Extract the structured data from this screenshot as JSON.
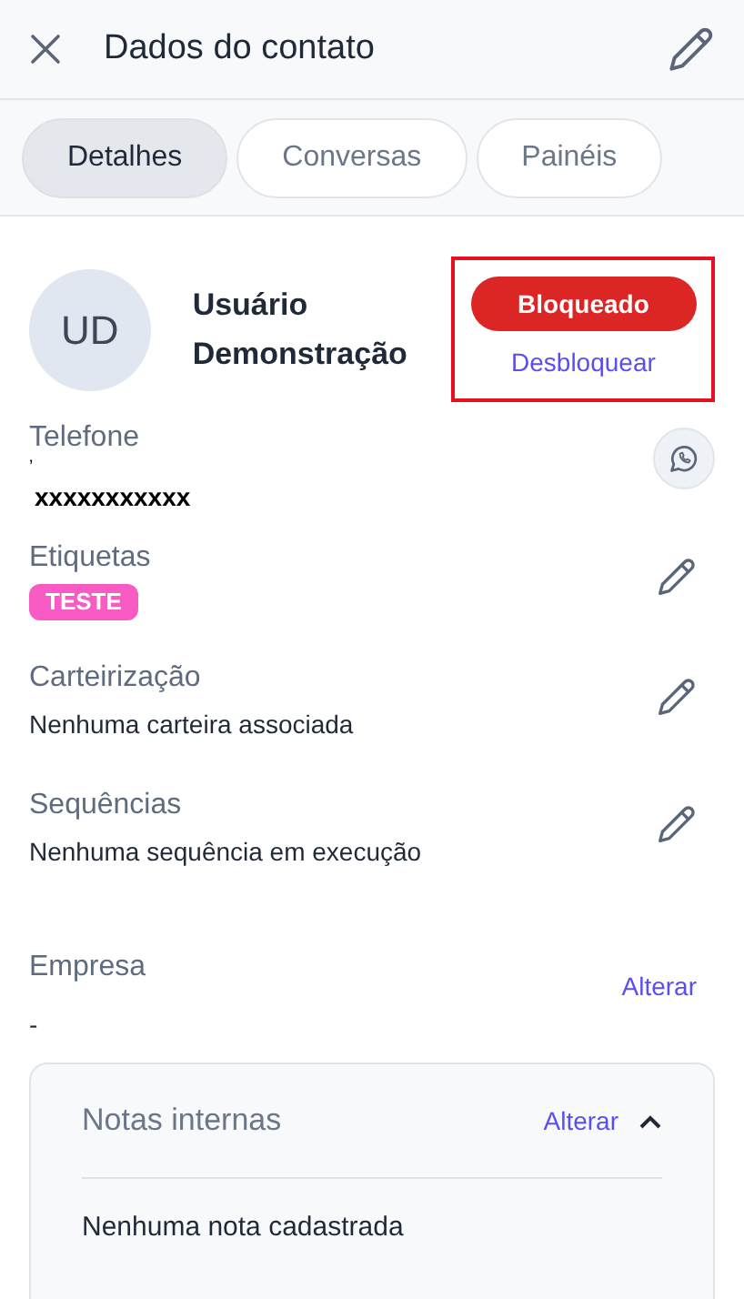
{
  "header": {
    "title": "Dados do contato"
  },
  "tabs": [
    {
      "label": "Detalhes",
      "selected": true
    },
    {
      "label": "Conversas",
      "selected": false
    },
    {
      "label": "Painéis",
      "selected": false
    }
  ],
  "contact": {
    "initials": "UD",
    "name": "Usuário Demonstração",
    "status": "Bloqueado",
    "action": "Desbloquear",
    "highlighted": true
  },
  "fields": [
    {
      "kind": "phone",
      "label": "Telefone",
      "prefix": "ʼ",
      "value": "xxxxxxxxxxx"
    },
    {
      "kind": "tag",
      "label": "Etiquetas",
      "tags": [
        {
          "text": "TESTE",
          "color": "#f85cc4"
        }
      ]
    },
    {
      "kind": "text",
      "label": "Carteirização",
      "value": "Nenhuma carteira associada"
    },
    {
      "kind": "text",
      "label": "Sequências",
      "value": "Nenhuma sequência em execução"
    },
    {
      "kind": "linked",
      "label": "Empresa",
      "value": "-",
      "link": "Alterar"
    }
  ],
  "notes": {
    "title": "Notas internas",
    "link": "Alterar",
    "expanded": true,
    "empty_text": "Nenhuma nota cadastrada"
  }
}
